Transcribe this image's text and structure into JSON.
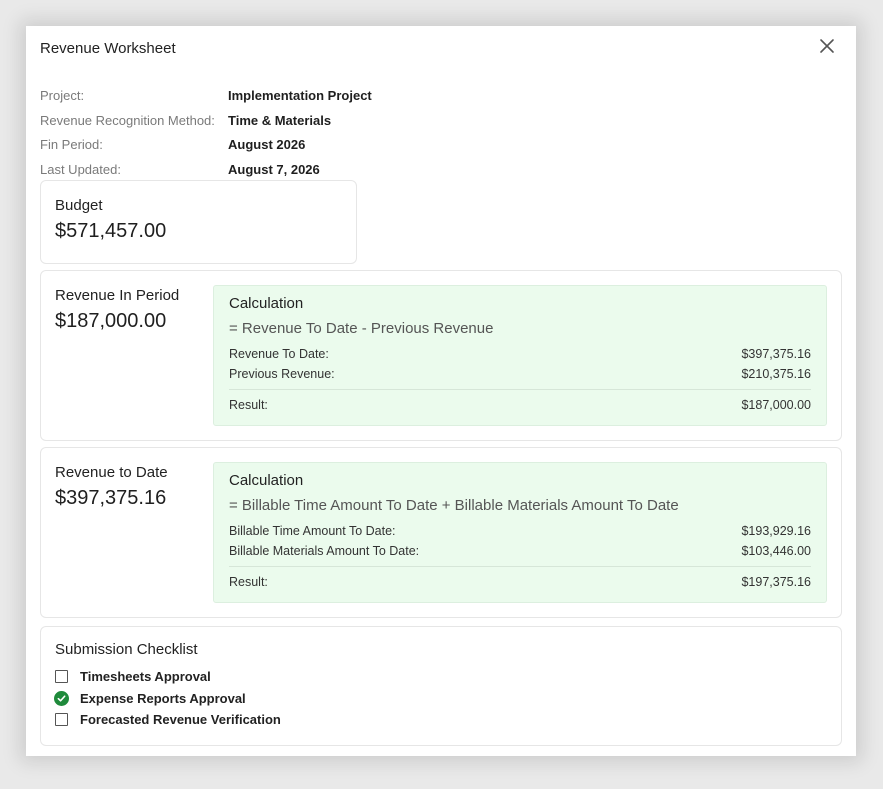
{
  "modal": {
    "title": "Revenue Worksheet"
  },
  "meta": [
    {
      "label": "Project:",
      "value": "Implementation Project"
    },
    {
      "label": "Revenue Recognition Method:",
      "value": "Time & Materials"
    },
    {
      "label": "Fin Period:",
      "value": "August 2026"
    },
    {
      "label": "Last Updated:",
      "value": "August 7, 2026"
    }
  ],
  "budget": {
    "label": "Budget",
    "amount": "$571,457.00"
  },
  "revenue_in_period": {
    "label": "Revenue In Period",
    "amount": "$187,000.00",
    "calc": {
      "title": "Calculation",
      "formula": "= Revenue To Date - Previous Revenue",
      "rows": [
        {
          "label": "Revenue To Date:",
          "value": "$397,375.16"
        },
        {
          "label": "Previous Revenue:",
          "value": "$210,375.16"
        }
      ],
      "result_label": "Result:",
      "result_value": "$187,000.00"
    }
  },
  "revenue_to_date": {
    "label": "Revenue to Date",
    "amount": "$397,375.16",
    "calc": {
      "title": "Calculation",
      "formula": "= Billable Time Amount To Date + Billable Materials Amount To Date",
      "rows": [
        {
          "label": "Billable Time Amount To Date:",
          "value": "$193,929.16"
        },
        {
          "label": "Billable Materials Amount To Date:",
          "value": "$103,446.00"
        }
      ],
      "result_label": "Result:",
      "result_value": "$197,375.16"
    }
  },
  "checklist": {
    "title": "Submission Checklist",
    "items": [
      {
        "label": "Timesheets Approval",
        "checked": false
      },
      {
        "label": "Expense Reports Approval",
        "checked": true
      },
      {
        "label": "Forecasted Revenue Verification",
        "checked": false
      }
    ]
  },
  "colors": {
    "calc_bg": "#ebfbed",
    "check_green": "#1f8a3b"
  },
  "icons": {
    "close": "close-icon",
    "checked": "check-circle-icon",
    "unchecked": "checkbox-icon"
  }
}
